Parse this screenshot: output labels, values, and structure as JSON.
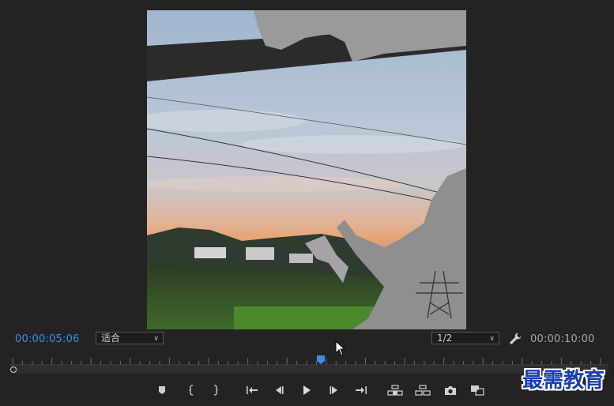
{
  "timecode": {
    "current": "00:00:05:06",
    "duration": "00:00:10:00"
  },
  "zoom_select": {
    "value": "适合"
  },
  "resolution_select": {
    "value": "1/2"
  },
  "playhead": {
    "position_fraction": 0.52
  },
  "watermark": {
    "text": "最需教育"
  },
  "icons": {
    "wrench": "wrench-icon",
    "marker": "add-marker-icon",
    "mark_in": "mark-in-icon",
    "mark_out": "mark-out-icon",
    "go_to_in": "go-to-in-icon",
    "step_back": "step-back-icon",
    "play": "play-icon",
    "step_forward": "step-forward-icon",
    "go_to_out": "go-to-out-icon",
    "lift": "lift-icon",
    "extract": "extract-icon",
    "export_frame": "camera-icon",
    "comparison_view": "comparison-view-icon"
  },
  "colors": {
    "accent": "#3a8ee6",
    "panel": "#232323"
  }
}
